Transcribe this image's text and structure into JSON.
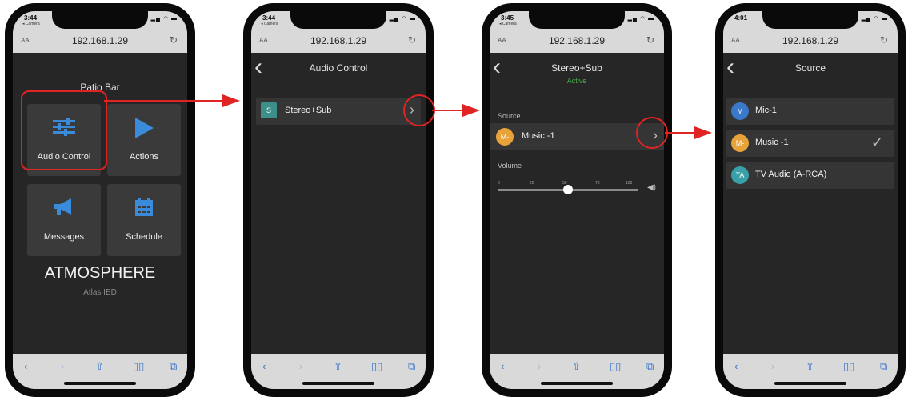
{
  "status_times": [
    "3:44",
    "3:44",
    "3:45",
    "4:01"
  ],
  "back_app_label": "◂ Camera",
  "url": "192.168.1.29",
  "aa_label": "AA",
  "accent_color": "#3a8bd9",
  "highlight_color": "#e02323",
  "screen1": {
    "title": "Patio Bar",
    "tiles": [
      {
        "label": "Audio Control",
        "icon": "sliders-icon"
      },
      {
        "label": "Actions",
        "icon": "play-icon"
      },
      {
        "label": "Messages",
        "icon": "megaphone-icon"
      },
      {
        "label": "Schedule",
        "icon": "calendar-icon"
      }
    ],
    "logo_text": "ATMOSPHERE",
    "brand_text": "Atlas IED"
  },
  "screen2": {
    "title": "Audio Control",
    "item": {
      "badge": "S",
      "label": "Stereo+Sub"
    }
  },
  "screen3": {
    "title": "Stereo+Sub",
    "status": "Active",
    "source_label": "Source",
    "source_value": {
      "badge": "M-",
      "label": "Music -1"
    },
    "volume_label": "Volume",
    "volume_ticks": [
      "0",
      "25",
      "50",
      "75",
      "100"
    ],
    "volume_value": 50
  },
  "screen4": {
    "title": "Source",
    "items": [
      {
        "badge": "M",
        "label": "Mic-1",
        "color": "#3a78c9",
        "selected": false
      },
      {
        "badge": "M-",
        "label": "Music -1",
        "color": "#e8a23a",
        "selected": true
      },
      {
        "badge": "TA",
        "label": "TV Audio (A-RCA)",
        "color": "#3aa0a8",
        "selected": false
      }
    ]
  }
}
